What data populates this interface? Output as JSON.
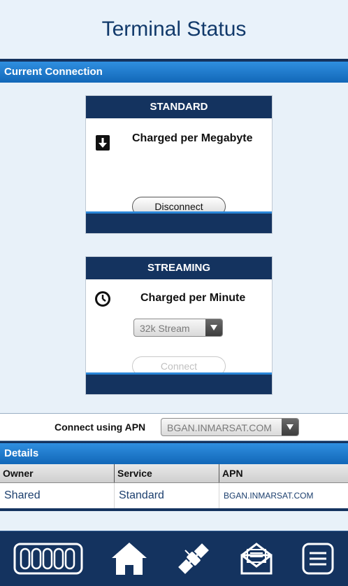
{
  "header": {
    "title": "Terminal Status"
  },
  "current_connection": {
    "section_label": "Current Connection",
    "standard": {
      "title": "STANDARD",
      "charge": "Charged per Megabyte",
      "button": "Disconnect"
    },
    "streaming": {
      "title": "STREAMING",
      "charge": "Charged per Minute",
      "stream_option": "32k Stream",
      "button": "Connect"
    }
  },
  "apn": {
    "label": "Connect using APN",
    "value": "BGAN.INMARSAT.COM"
  },
  "details": {
    "section_label": "Details",
    "columns": [
      "Owner",
      "Service",
      "APN"
    ],
    "rows": [
      [
        "Shared",
        "Standard",
        "BGAN.INMARSAT.COM"
      ]
    ]
  },
  "bottom_nav": {
    "icons": [
      "signal-bars-icon",
      "home-icon",
      "satellite-icon",
      "mail-icon",
      "menu-icon"
    ]
  },
  "colors": {
    "navy": "#14335f",
    "accent_blue": "#1a73c8",
    "title_text": "#123a6b"
  }
}
